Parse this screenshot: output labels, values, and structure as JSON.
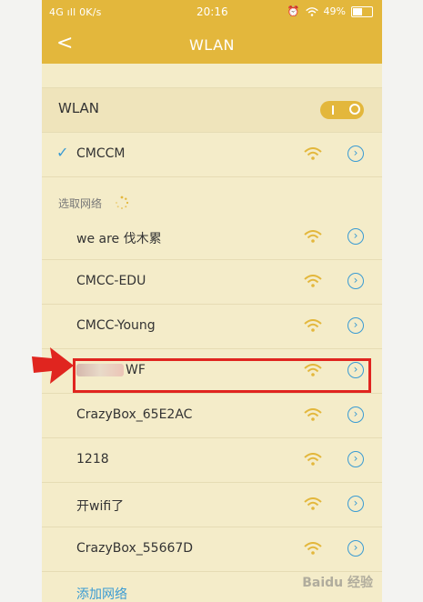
{
  "status_bar": {
    "left": "4G ıll  0K/s",
    "time": "20:16",
    "battery": "49%"
  },
  "header": {
    "back_glyph": "<",
    "title": "WLAN"
  },
  "wlan_toggle": {
    "label": "WLAN",
    "state": "on"
  },
  "connected": {
    "check": "✓",
    "name": "CMCCM"
  },
  "section": {
    "label": "选取网络"
  },
  "networks": [
    {
      "name": "we are 伐木累"
    },
    {
      "name": "CMCC-EDU"
    },
    {
      "name": "CMCC-Young"
    },
    {
      "name": "WF",
      "obscured": true
    },
    {
      "name": "CrazyBox_65E2AC"
    },
    {
      "name": "1218"
    },
    {
      "name": "开wifi了"
    },
    {
      "name": "CrazyBox_55667D"
    }
  ],
  "add_network": {
    "label": "添加网络"
  },
  "watermark": "Baidu 经验",
  "colors": {
    "header": "#e3b73c",
    "background": "#f4ecc9",
    "accent": "#3a9bd3",
    "wifi": "#e3b73c",
    "highlight": "#e0251f"
  }
}
